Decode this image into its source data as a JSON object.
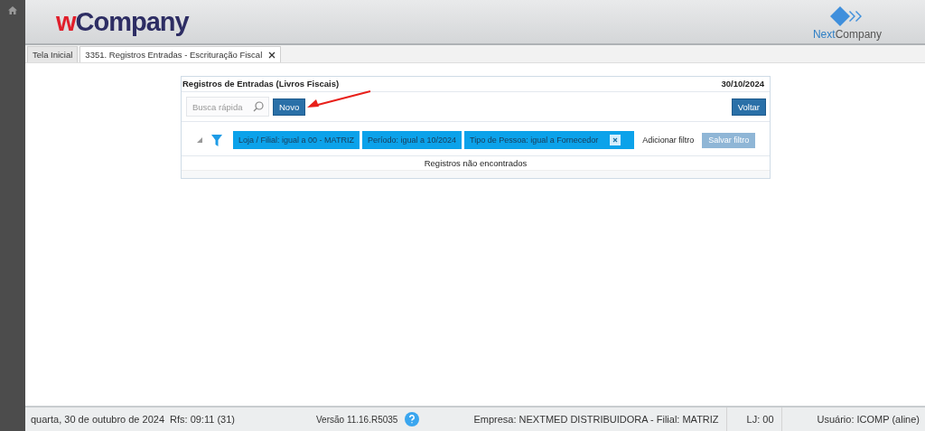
{
  "header": {
    "logo": {
      "prefix": "w",
      "rest": "Company"
    },
    "brand": {
      "prefix": "Next",
      "rest": "Company"
    }
  },
  "tabs": [
    {
      "label": "Tela Inicial",
      "selected": false,
      "closable": false
    },
    {
      "label": "3351. Registros Entradas - Escrituração Fiscal",
      "selected": true,
      "closable": true
    }
  ],
  "panel": {
    "title": "Registros de Entradas (Livros Fiscais)",
    "date": "30/10/2024",
    "search": {
      "placeholder": "Busca rápida"
    },
    "new_button": "Novo",
    "back_button": "Voltar",
    "filters": [
      {
        "label": "Loja / Filial: igual a 00 - MATRIZ",
        "removable": false
      },
      {
        "label": "Período: igual a 10/2024",
        "removable": false
      },
      {
        "label": "Tipo de Pessoa: igual a Fornecedor",
        "removable": true
      }
    ],
    "add_filter": "Adicionar filtro",
    "save_filter": {
      "label": "Salvar filtro",
      "disabled": true
    },
    "empty_message": "Registros não encontrados"
  },
  "status_bar": {
    "date": "quarta, 30 de outubro de 2024",
    "refresh": "Rfs: 09:11 (31)",
    "version": "Versão 11.16.R5035",
    "company": "Empresa: NEXTMED DISTRIBUIDORA - Filial: MATRIZ",
    "store": "LJ: 00",
    "user": "Usuário: ICOMP (aline)"
  }
}
